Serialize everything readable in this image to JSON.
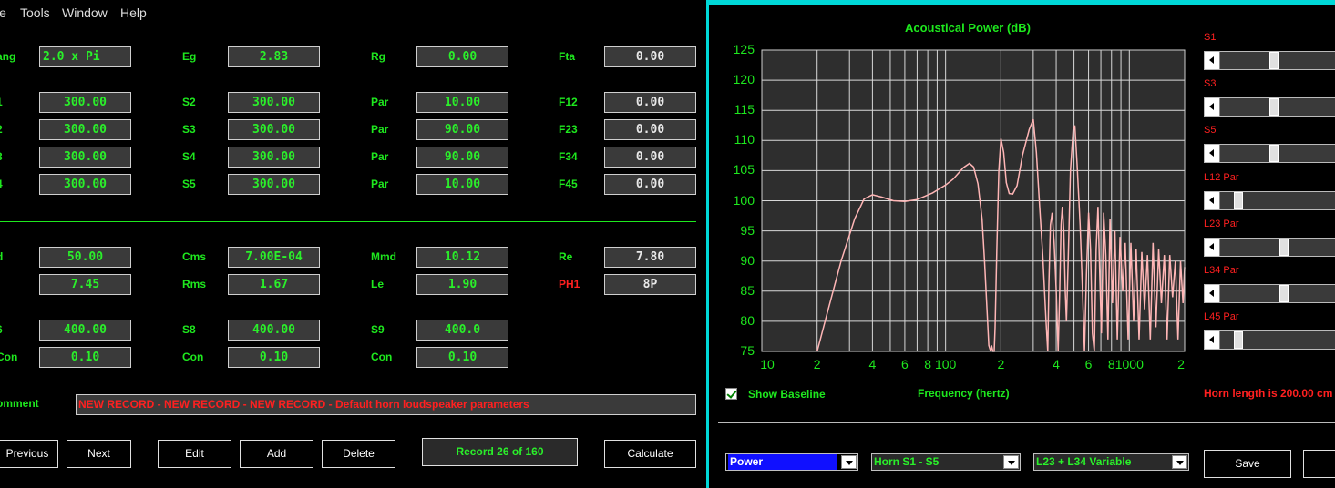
{
  "menu": [
    "le",
    "Tools",
    "Window",
    "Help"
  ],
  "params_top": [
    {
      "label": "ang",
      "value": "2.0 x Pi",
      "left": true
    },
    {
      "label": "Eg",
      "value": "2.83"
    },
    {
      "label": "Rg",
      "value": "0.00"
    },
    {
      "label": "Fta",
      "value": "0.00",
      "white": true
    }
  ],
  "params_sections": [
    [
      {
        "label": "1",
        "value": "300.00"
      },
      {
        "label": "S2",
        "value": "300.00"
      },
      {
        "label": "Par",
        "value": "10.00"
      },
      {
        "label": "F12",
        "value": "0.00"
      }
    ],
    [
      {
        "label": "2",
        "value": "300.00"
      },
      {
        "label": "S3",
        "value": "300.00"
      },
      {
        "label": "Par",
        "value": "90.00"
      },
      {
        "label": "F23",
        "value": "0.00"
      }
    ],
    [
      {
        "label": "3",
        "value": "300.00"
      },
      {
        "label": "S4",
        "value": "300.00"
      },
      {
        "label": "Par",
        "value": "90.00"
      },
      {
        "label": "F34",
        "value": "0.00"
      }
    ],
    [
      {
        "label": "4",
        "value": "300.00"
      },
      {
        "label": "S5",
        "value": "300.00"
      },
      {
        "label": "Par",
        "value": "10.00"
      },
      {
        "label": "F45",
        "value": "0.00"
      }
    ]
  ],
  "driver": [
    [
      {
        "label": "d",
        "value": "50.00"
      },
      {
        "label": "Cms",
        "value": "7.00E-04"
      },
      {
        "label": "Mmd",
        "value": "10.12"
      },
      {
        "label": "Re",
        "value": "7.80"
      }
    ],
    [
      {
        "label": "l",
        "value": "7.45"
      },
      {
        "label": "Rms",
        "value": "1.67"
      },
      {
        "label": "Le",
        "value": "1.90"
      },
      {
        "label": "PH1",
        "value": "8P"
      }
    ]
  ],
  "chambers": [
    [
      {
        "label": "6",
        "value": "400.00"
      },
      {
        "label": "S8",
        "value": "400.00"
      },
      {
        "label": "S9",
        "value": "400.0"
      }
    ],
    [
      {
        "label": "Con",
        "value": "0.10"
      },
      {
        "label": "Con",
        "value": "0.10"
      },
      {
        "label": "Con",
        "value": "0.10"
      }
    ]
  ],
  "comment": {
    "label": "omment",
    "value": "NEW RECORD - NEW RECORD - NEW RECORD - Default horn loudspeaker parameters"
  },
  "buttons": {
    "previous": "Previous",
    "next": "Next",
    "edit": "Edit",
    "add": "Add",
    "delete": "Delete",
    "record": "Record 26 of 160",
    "calculate": "Calculate",
    "save": "Save"
  },
  "chart_data": {
    "type": "line",
    "title": "Acoustical Power (dB)",
    "xlabel": "Frequency (hertz)",
    "ylabel": "",
    "x_scale": "log",
    "xlim": [
      10,
      2000
    ],
    "ylim": [
      75,
      125
    ],
    "grid": true,
    "y_ticks": [
      "125",
      "120",
      "115",
      "110",
      "105",
      "100",
      "95",
      "90",
      "85",
      "80",
      "75"
    ],
    "x_tick_labels": [
      "10",
      "2",
      "4",
      "6",
      "8",
      "100",
      "2",
      "4",
      "6",
      "8",
      "1000",
      "2"
    ],
    "series": [
      {
        "color": "#ffb6b6",
        "points": [
          [
            20,
            75
          ],
          [
            23,
            82
          ],
          [
            27,
            90
          ],
          [
            32,
            97
          ],
          [
            36,
            100.3
          ],
          [
            40,
            101
          ],
          [
            45,
            100.6
          ],
          [
            52,
            100
          ],
          [
            60,
            99.9
          ],
          [
            70,
            100.2
          ],
          [
            85,
            101.3
          ],
          [
            100,
            102.6
          ],
          [
            110,
            103.6
          ],
          [
            125,
            105.5
          ],
          [
            135,
            106.2
          ],
          [
            142,
            105.6
          ],
          [
            150,
            102.8
          ],
          [
            158,
            97
          ],
          [
            163,
            90
          ],
          [
            168,
            82
          ],
          [
            172,
            76
          ],
          [
            176,
            75
          ],
          [
            178,
            76
          ],
          [
            181,
            75
          ],
          [
            184,
            75
          ],
          [
            186,
            79
          ],
          [
            190,
            92
          ],
          [
            195,
            105
          ],
          [
            200,
            110.3
          ],
          [
            207,
            108
          ],
          [
            214,
            103
          ],
          [
            222,
            101.2
          ],
          [
            232,
            101.1
          ],
          [
            245,
            102.5
          ],
          [
            262,
            107.5
          ],
          [
            285,
            111.8
          ],
          [
            300,
            113.5
          ],
          [
            312,
            108
          ],
          [
            325,
            99
          ],
          [
            338,
            91
          ],
          [
            352,
            80
          ],
          [
            360,
            75
          ],
          [
            365,
            86
          ],
          [
            372,
            96
          ],
          [
            380,
            98
          ],
          [
            390,
            93
          ],
          [
            400,
            85
          ],
          [
            410,
            75
          ],
          [
            418,
            85
          ],
          [
            425,
            96
          ],
          [
            432,
            99
          ],
          [
            440,
            95
          ],
          [
            448,
            85
          ],
          [
            455,
            80
          ],
          [
            465,
            90
          ],
          [
            478,
            105
          ],
          [
            495,
            111.8
          ],
          [
            505,
            112.5
          ],
          [
            520,
            106
          ],
          [
            540,
            96
          ],
          [
            555,
            86
          ],
          [
            570,
            75
          ],
          [
            585,
            88
          ],
          [
            600,
            98
          ],
          [
            615,
            92
          ],
          [
            630,
            78
          ],
          [
            645,
            75
          ],
          [
            660,
            92
          ],
          [
            675,
            99
          ],
          [
            690,
            88
          ],
          [
            705,
            78
          ],
          [
            725,
            98
          ],
          [
            745,
            91
          ],
          [
            765,
            77
          ],
          [
            785,
            97
          ],
          [
            810,
            83
          ],
          [
            835,
            95
          ],
          [
            860,
            77
          ],
          [
            890,
            94
          ],
          [
            920,
            85
          ],
          [
            950,
            93
          ],
          [
            985,
            77
          ],
          [
            1020,
            93
          ],
          [
            1055,
            80
          ],
          [
            1090,
            92
          ],
          [
            1130,
            77
          ],
          [
            1170,
            91.5
          ],
          [
            1210,
            82
          ],
          [
            1255,
            91
          ],
          [
            1300,
            77
          ],
          [
            1345,
            93
          ],
          [
            1395,
            79
          ],
          [
            1445,
            92
          ],
          [
            1495,
            83
          ],
          [
            1550,
            91
          ],
          [
            1605,
            77
          ],
          [
            1660,
            91
          ],
          [
            1720,
            84
          ],
          [
            1780,
            90
          ],
          [
            1840,
            77
          ],
          [
            1900,
            90
          ],
          [
            1960,
            83
          ],
          [
            2000,
            89
          ]
        ]
      }
    ]
  },
  "chart_controls": {
    "show_baseline": "Show Baseline",
    "horn_length": "Horn length is 200.00 cm"
  },
  "sliders": [
    {
      "label": "S1",
      "value": 0.48
    },
    {
      "label": "S3",
      "value": 0.48
    },
    {
      "label": "S5",
      "value": 0.48
    },
    {
      "label": "L12  Par",
      "value": 0.13
    },
    {
      "label": "L23  Par",
      "value": 0.58
    },
    {
      "label": "L34  Par",
      "value": 0.58
    },
    {
      "label": "L45  Par",
      "value": 0.13
    }
  ],
  "dropdowns": {
    "plot": "Power",
    "horn": "Horn S1 - S5",
    "variable": "L23 + L34 Variable"
  },
  "colors": {
    "accent": "#00d8d8",
    "label_green": "#1ee81e",
    "warning_red": "#ff2020",
    "curve": "#ffb6b6"
  }
}
